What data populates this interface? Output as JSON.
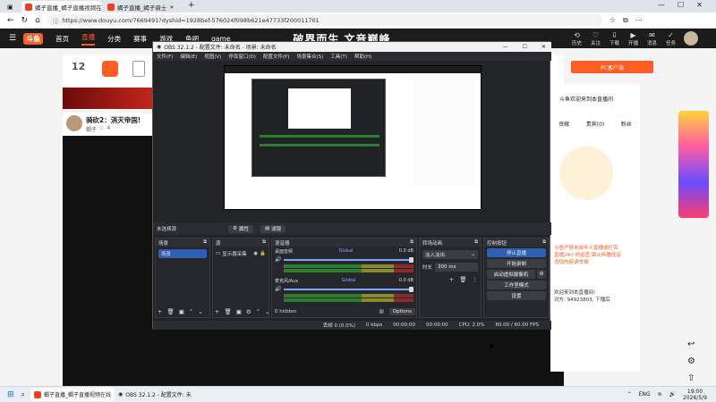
{
  "browser": {
    "tabs": [
      {
        "title": "蝎子直播_蝎子直播视频在线"
      },
      {
        "title": "蝎子直播_蝎子骑士"
      }
    ],
    "url": "https://www.douyu.com/7669491?dyshid=1928bef-576024f098b621e47733f200011701"
  },
  "site": {
    "logo": "斗鱼",
    "nav": [
      "首页",
      "直播",
      "分类",
      "赛事",
      "游戏",
      "鱼吧",
      "game"
    ],
    "search_banner": "破界而生 文音巅峰",
    "header_icons": [
      {
        "icon": "history-icon",
        "glyph": "⟲",
        "label": "历史"
      },
      {
        "icon": "follow-icon",
        "glyph": "♡",
        "label": "关注"
      },
      {
        "icon": "download-icon",
        "glyph": "⇩",
        "label": "下载"
      },
      {
        "icon": "live-icon",
        "glyph": "▶",
        "label": "开播"
      },
      {
        "icon": "message-icon",
        "glyph": "✉",
        "label": "消息"
      },
      {
        "icon": "task-icon",
        "glyph": "✓",
        "label": "任务"
      }
    ],
    "pc_client": "PC客户端",
    "room_number": "12",
    "room_title": "骑砍2：消灭帝国!",
    "anchor_name": "蝎子",
    "room_count": "4",
    "right_panel": {
      "tabs": [
        "贡献",
        "贵宾(0)",
        "粉丝"
      ],
      "notice": "斗鱼欢迎来到本直播间",
      "chat": [
        "斗鱼严禁未成年人直播或打赏",
        "直播24小时巡查,禁止传播低俗",
        "违规内容请举报",
        "欢迎来到本直播间!",
        "对方: 94923803, 下播后"
      ]
    }
  },
  "obs": {
    "title": "OBS 32.1.2 - 配置文件: 未命名 - 场景: 未命名",
    "menu": [
      "文件(F)",
      "编辑(E)",
      "视图(V)",
      "停靠窗口(D)",
      "配置文件(P)",
      "场景集合(S)",
      "工具(T)",
      "帮助(H)"
    ],
    "no_source": "未选择源",
    "toolbar": {
      "settings": "属性",
      "filters": "滤镜"
    },
    "docks": {
      "scenes": "场景",
      "sources": "源",
      "mixer": "混音器",
      "transitions": "转场动画",
      "controls": "控制按钮"
    },
    "scene_item": "场景",
    "source_item": "显示器采集",
    "mixer_tracks": [
      {
        "name": "桌面音频",
        "tag": "Global",
        "db": "0.0 dB"
      },
      {
        "name": "麦克风/Aux",
        "tag": "Global",
        "db": "0.0 dB"
      }
    ],
    "mixer_hidden": "0 hidden",
    "mixer_options": "Options",
    "transition": {
      "type": "淡入淡出",
      "duration_label": "时长",
      "duration": "300 ms"
    },
    "controls": [
      "停止直播",
      "开始录制",
      "启动虚拟摄像机",
      "工作室模式",
      "设置"
    ],
    "status": [
      "丢帧 0 (0.0%)",
      "0 kbps",
      "00:00:00",
      "00:00:00",
      "CPU: 2.0%",
      "60.00 / 60.00 FPS"
    ]
  },
  "taskbar": {
    "items": [
      {
        "label": "蝎子直播_蝎子直播视频在线"
      },
      {
        "label": "OBS 32.1.2 - 配置文件: 未"
      }
    ],
    "lang": "ENG",
    "time": "19:00",
    "date": "2026/5/9"
  }
}
